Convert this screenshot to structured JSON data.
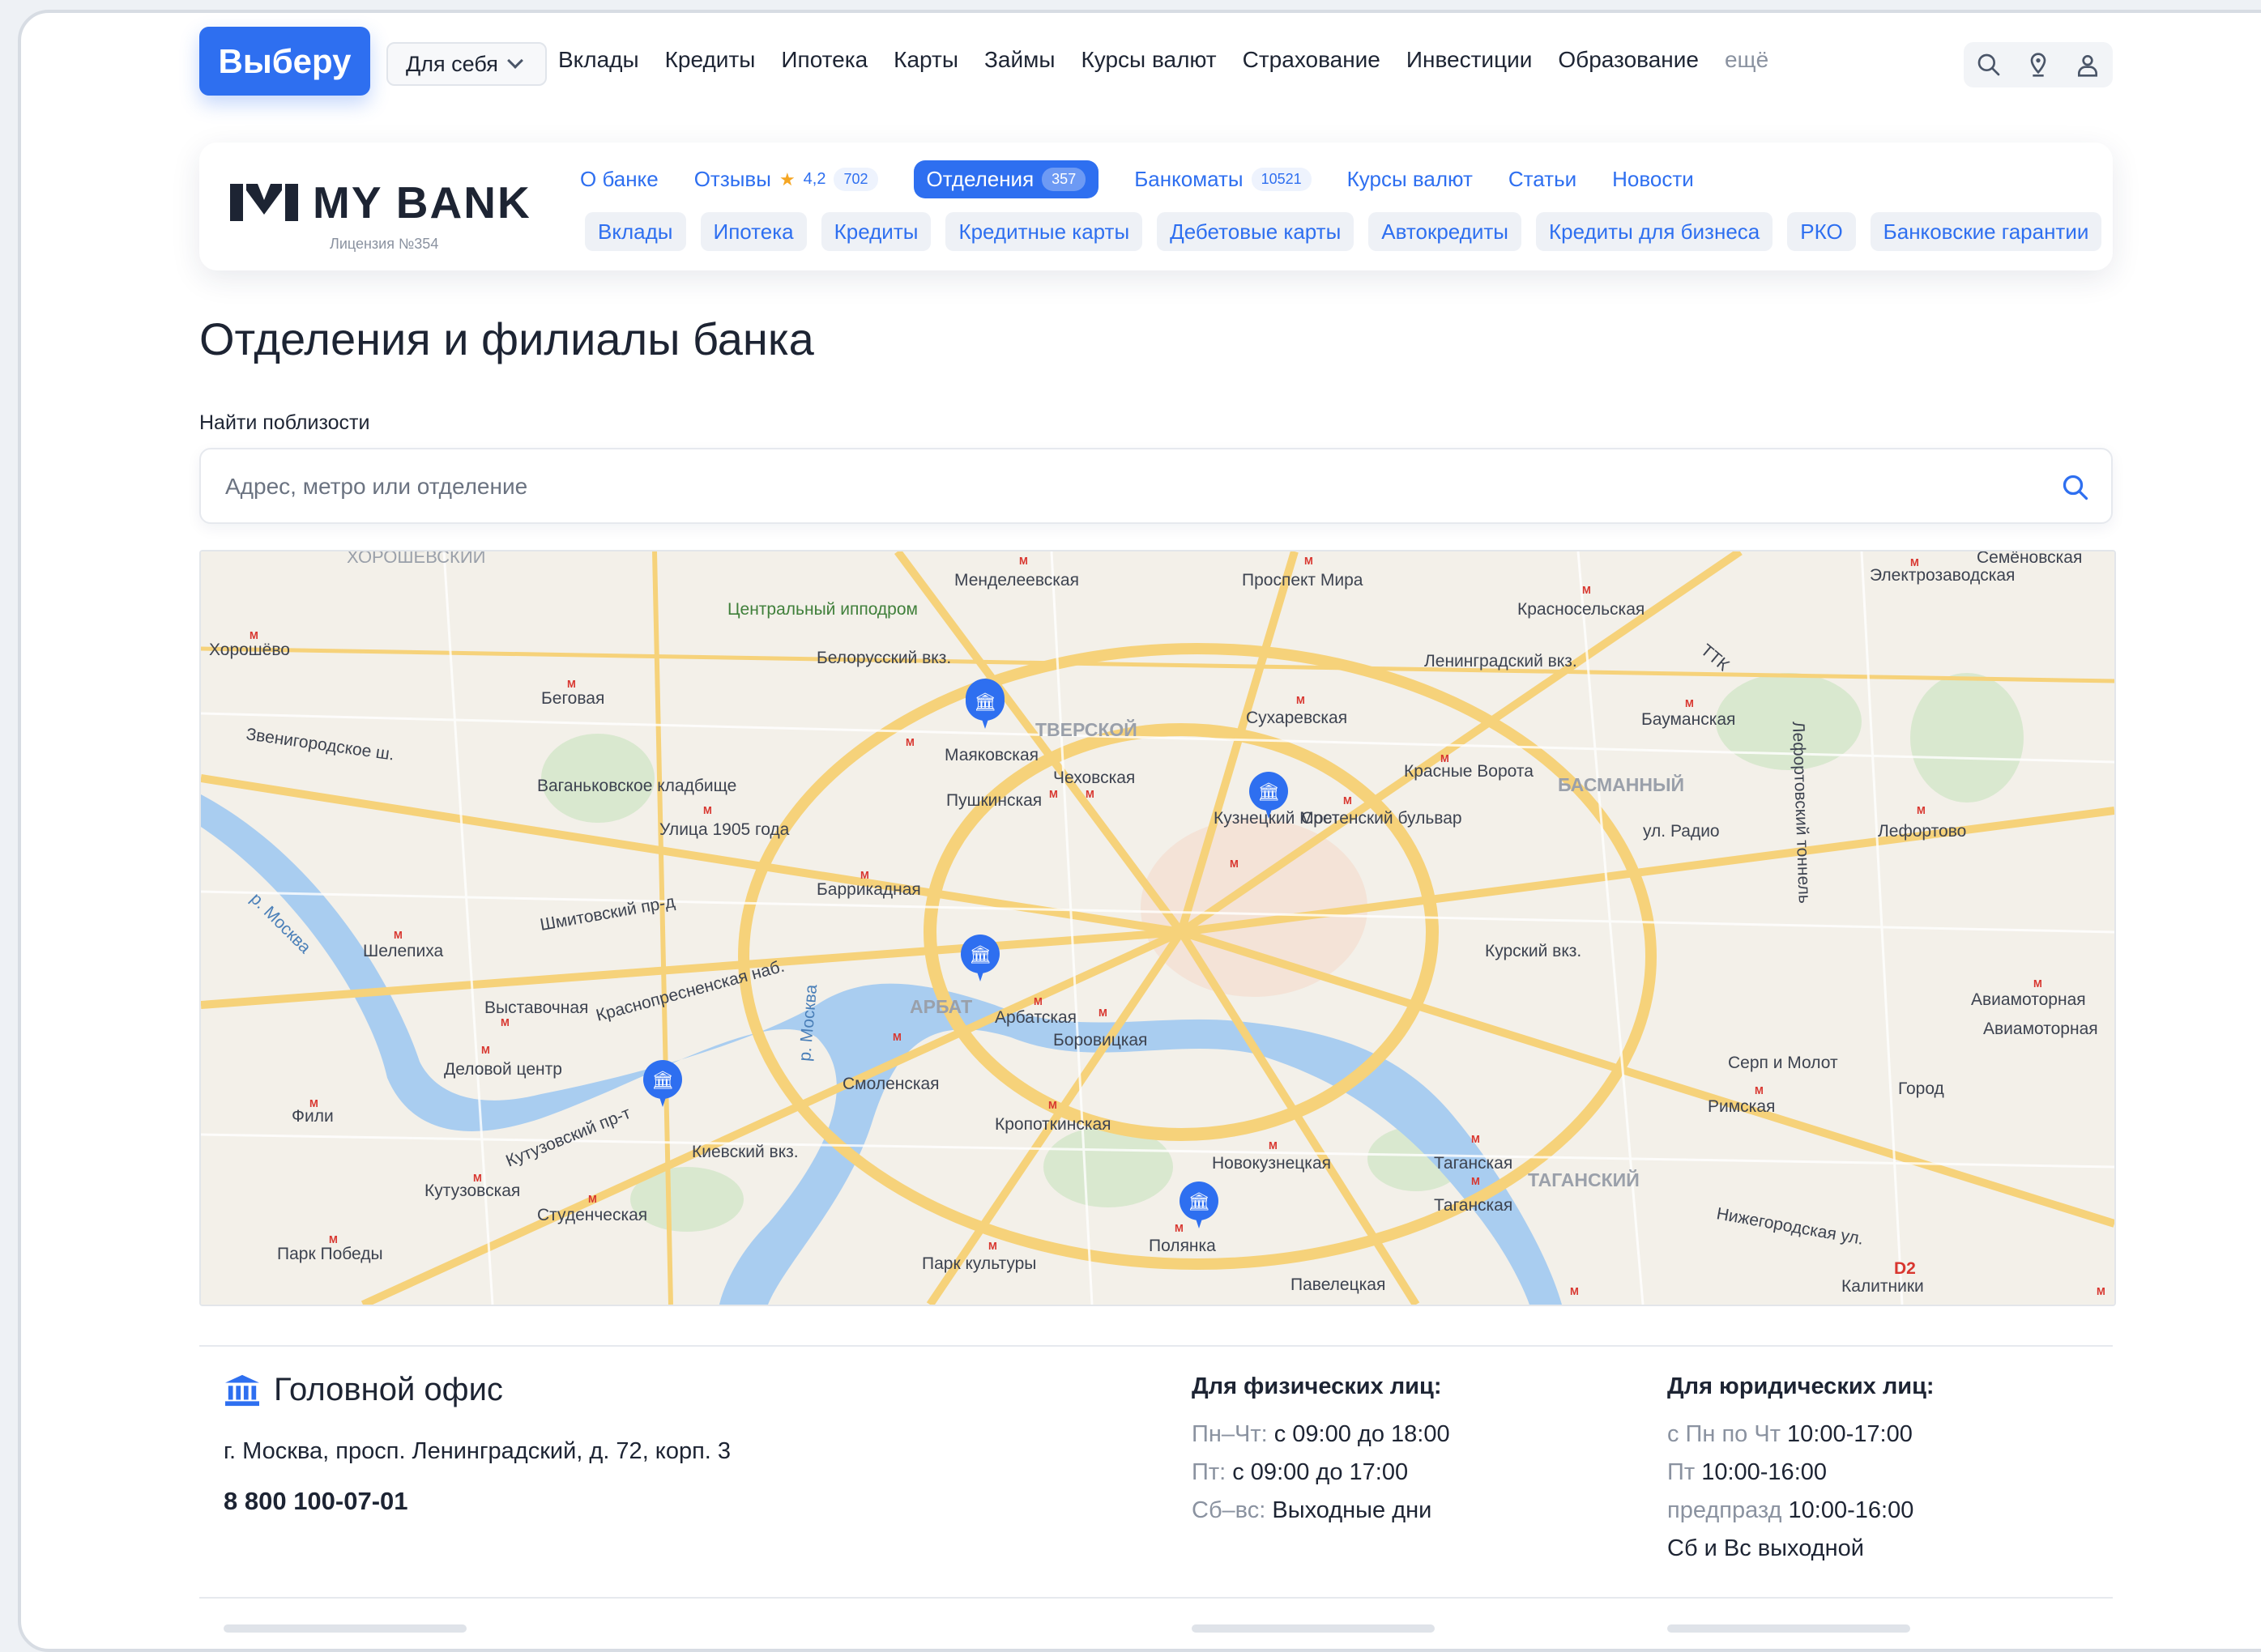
{
  "topbar": {
    "logo": "Выберу",
    "dropdown": "Для себя",
    "nav": [
      "Вклады",
      "Кредиты",
      "Ипотека",
      "Карты",
      "Займы",
      "Курсы валют",
      "Страхование",
      "Инвестиции",
      "Образование"
    ],
    "more": "ещё"
  },
  "bank": {
    "name": "MY BANK",
    "license": "Лицензия №354",
    "tabs": {
      "about": "О банке",
      "reviews": "Отзывы",
      "rating": "4,2",
      "reviews_count": "702",
      "branches": "Отделения",
      "branches_count": "357",
      "atms": "Банкоматы",
      "atms_count": "10521",
      "rates": "Курсы валют",
      "articles": "Статьи",
      "news": "Новости"
    },
    "products": [
      "Вклады",
      "Ипотека",
      "Кредиты",
      "Кредитные карты",
      "Дебетовые карты",
      "Автокредиты",
      "Кредиты для бизнеса",
      "РКО",
      "Банковские гарантии"
    ]
  },
  "page": {
    "title": "Отделения и филиалы банка",
    "find_label": "Найти поблизости",
    "search_placeholder": "Адрес, метро или отделение"
  },
  "map": {
    "labels": {
      "hippodrome": "Центральный ипподром",
      "belorussky": "Белорусский вкз.",
      "mendeleevskaya": "Менделеевская",
      "prospekt_mira": "Проспект Мира",
      "krasnoselskaya": "Красносельская",
      "leningradsky": "Ленинградский вкз.",
      "elektrozavodskaya": "Электрозаводская",
      "semenovskaya": "Семёновская",
      "khoroshevo": "Хорошёво",
      "khoroshevsky": "ХОРОШЁВСКИЙ",
      "begovaya": "Беговая",
      "zvenigorodskoe": "Звенигородское ш.",
      "vagankovskoe": "Ваганьковское кладбище",
      "ulitsa1905": "Улица 1905 года",
      "tverskoy": "ТВЕРСКОЙ",
      "mayakovskaya": "Маяковская",
      "chekhovskaya": "Чеховская",
      "pushkinskaya": "Пушкинская",
      "sukharevskaya": "Сухаревская",
      "baumanskaya": "Бауманская",
      "krasnye_vorota": "Красные Ворота",
      "basmanny": "БАСМАННЫЙ",
      "kuznetsky": "Кузнецкий Мост",
      "sretensky": "Сретенский бульвар",
      "barrikadnaya": "Баррикадная",
      "ul_radio": "ул. Радио",
      "lefortovo": "Лефортово",
      "shelepikha": "Шелепиха",
      "shmitovsky": "Шмитовский пр-д",
      "krasnopresnenskaya": "Краснопресненская наб.",
      "vystavochnaya": "Выставочная",
      "delovoy": "Деловой центр",
      "arbat": "АРБАТ",
      "arbatskaya": "Арбатская",
      "borovitskaya": "Боровицкая",
      "smolenskaya": "Смоленская",
      "kursky": "Курский вкз.",
      "aviamotornaya1": "Авиамоторная",
      "aviamotornaya2": "Авиамоторная",
      "serp_molot": "Серп и Молот",
      "gorod": "Город",
      "rimskaya": "Римская",
      "fili": "Фили",
      "kutuzovsky_pr": "Кутузовский пр-т",
      "kievsky": "Киевский вкз.",
      "kropotkinskaya": "Кропоткинская",
      "novokuznetskaya": "Новокузнецкая",
      "taganskaya1": "Таганская",
      "taganskaya2": "Таганская",
      "tagansky": "ТАГАНСКИЙ",
      "kutuzovskaya": "Кутузовская",
      "studencheskaya": "Студенческая",
      "park_pobedy": "Парк Победы",
      "park_kultury": "Парк культуры",
      "polyanka": "Полянка",
      "paveletskaya": "Павелецкая",
      "nizhegorodskaya": "Нижегородская ул.",
      "kalitniki": "Калитники",
      "d2": "D2",
      "ttk": "ТТК",
      "lefortovsky_tunnel": "Лефортовский тоннель",
      "r_moskva1": "р. Москва",
      "r_moskva2": "р. Москва"
    }
  },
  "office": {
    "title": "Головной офис",
    "address": "г. Москва, просп. Ленинградский, д. 72, корп. 3",
    "phone": "8 800 100-07-01",
    "individuals": {
      "heading": "Для физических лиц:",
      "rows": [
        {
          "label": "Пн–Чт:",
          "value": "с 09:00 до 18:00"
        },
        {
          "label": "Пт:",
          "value": "с 09:00 до 17:00"
        },
        {
          "label": "Сб–вс:",
          "value": "Выходные дни"
        }
      ]
    },
    "legal": {
      "heading": "Для юридических лиц:",
      "rows": [
        {
          "label": "с Пн по Чт",
          "value": "10:00-17:00"
        },
        {
          "label": "Пт",
          "value": "10:00-16:00"
        },
        {
          "label": "предпразд",
          "value": "10:00-16:00"
        },
        {
          "label": "",
          "value": "Сб и Вс выходной"
        }
      ]
    }
  },
  "colors": {
    "accent": "#2e6ff0",
    "metro": "#d8362f",
    "road_major": "#f6d27a",
    "water": "#a9cdf0",
    "park": "#cfe6c1"
  }
}
